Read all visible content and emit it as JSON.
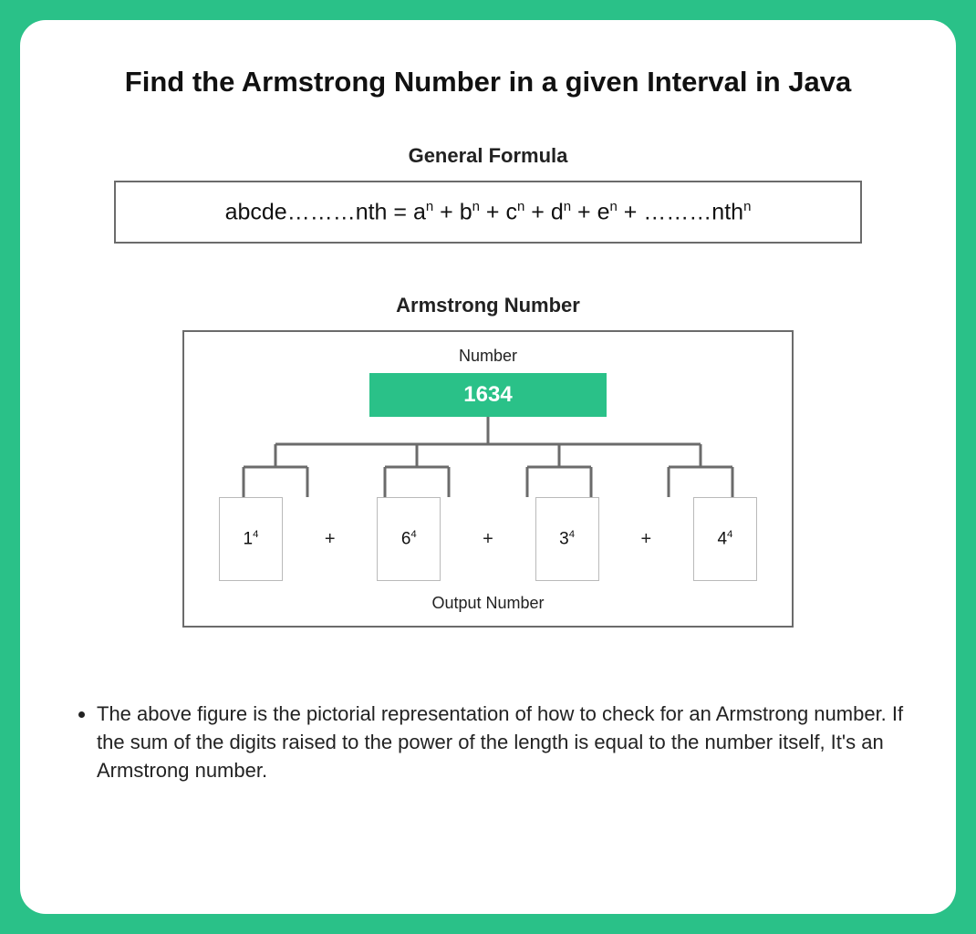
{
  "title": "Find the Armstrong Number in a given Interval in Java",
  "formula": {
    "heading": "General Formula",
    "prefix": "abcde………nth = ",
    "terms": [
      "a",
      "b",
      "c",
      "d",
      "e"
    ],
    "exp": "n",
    "suffix": " + ………nth"
  },
  "diagram": {
    "heading": "Armstrong Number",
    "top_label": "Number",
    "number": "1634",
    "digits": [
      {
        "base": "1",
        "exp": "4"
      },
      {
        "base": "6",
        "exp": "4"
      },
      {
        "base": "3",
        "exp": "4"
      },
      {
        "base": "4",
        "exp": "4"
      }
    ],
    "plus": "+",
    "bottom_label": "Output Number"
  },
  "description": "The above figure is the pictorial representation of how to check for an Armstrong number. If the sum of the digits raised to the power of the length is equal to the number itself, It's an Armstrong number."
}
